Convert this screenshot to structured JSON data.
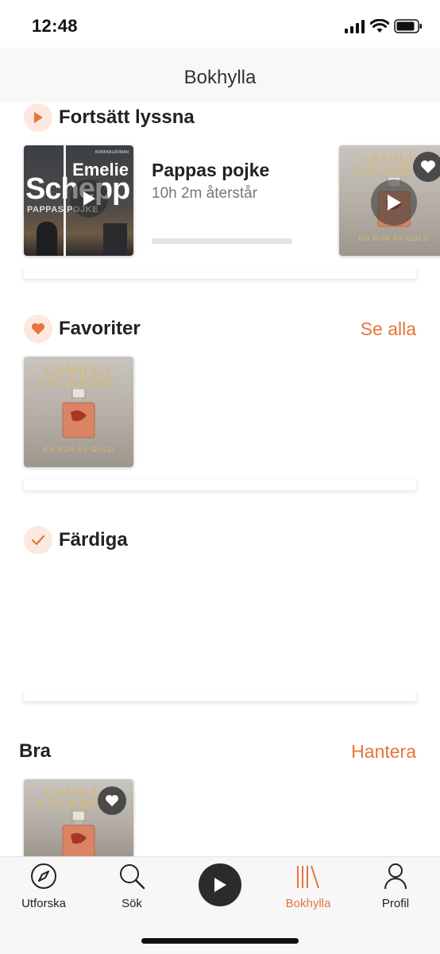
{
  "status": {
    "time": "12:48"
  },
  "header": {
    "title": "Bokhylla"
  },
  "continue_listening": {
    "title": "Fortsätt lyssna",
    "book": {
      "title": "Pappas pojke",
      "remaining": "10h 2m återstår",
      "progress": 0
    },
    "cover1": {
      "author_line1": "Emelie",
      "author_line2": "Schepp",
      "book_title": "PAPPAS POJKE",
      "genre": "KRIMINALROMAN"
    },
    "cover2": {
      "author_line1": "CAMILLA",
      "author_line2": "LÄCKBERG",
      "book_title": "EN BUR AV GULD"
    }
  },
  "favorites": {
    "title": "Favoriter",
    "see_all": "Se alla",
    "cover": {
      "author_line1": "CAMILLA",
      "author_line2": "LÄCKBERG",
      "book_title": "EN BUR AV GULD"
    }
  },
  "finished": {
    "title": "Färdiga"
  },
  "bra": {
    "title": "Bra",
    "manage": "Hantera",
    "cover": {
      "author_line1": "CAMILLA",
      "author_line2": "LÄCKBERG"
    }
  },
  "tabbar": {
    "items": [
      {
        "label": "Utforska",
        "icon": "compass-icon"
      },
      {
        "label": "Sök",
        "icon": "search-icon"
      },
      {
        "label": "",
        "icon": "play-icon"
      },
      {
        "label": "Bokhylla",
        "icon": "bookshelf-icon",
        "active": true
      },
      {
        "label": "Profil",
        "icon": "profile-icon"
      }
    ]
  },
  "colors": {
    "accent": "#e8733a",
    "accent_light": "#fbe9df",
    "text": "#222222"
  }
}
